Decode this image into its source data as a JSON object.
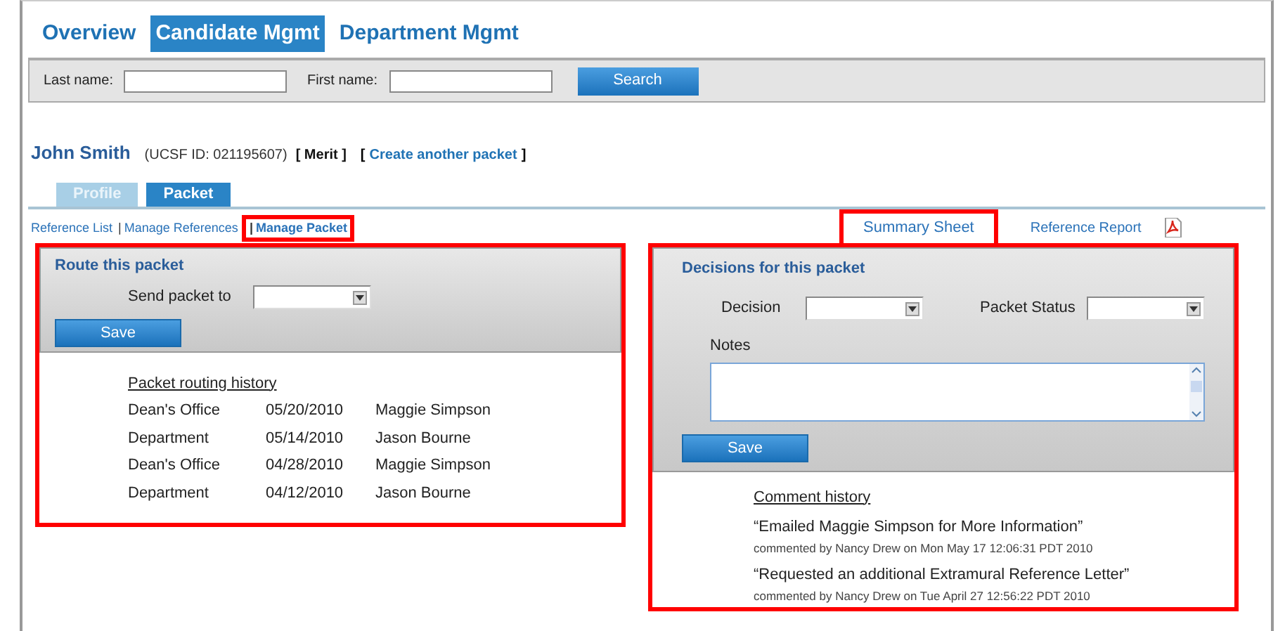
{
  "nav_tabs": [
    {
      "label": "Overview",
      "selected": false
    },
    {
      "label": "Candidate Mgmt",
      "selected": true
    },
    {
      "label": "Department Mgmt",
      "selected": false
    }
  ],
  "search": {
    "last_name_label": "Last name:",
    "first_name_label": "First name:",
    "button": "Search"
  },
  "candidate": {
    "name": "John Smith",
    "id": "(UCSF ID: 021195607)",
    "type": "[ Merit ]",
    "link_open": "[",
    "link": "Create another packet",
    "link_close": "]"
  },
  "sub_tabs": [
    {
      "label": "Profile",
      "selected": false
    },
    {
      "label": "Packet",
      "selected": true
    }
  ],
  "left_links": [
    {
      "label": "Reference List",
      "highlighted": false
    },
    {
      "separator": "|",
      "label": "Manage References",
      "highlighted": false
    },
    {
      "separator": "|",
      "label": "Manage Packet",
      "highlighted": true
    }
  ],
  "right_links": [
    {
      "kind": "link",
      "label": "Summary Sheet",
      "highlighted": true
    },
    {
      "kind": "pdf_link",
      "label": "Reference Report",
      "highlighted": false
    }
  ],
  "route_panel": {
    "title": "Route this packet",
    "highlighted": true,
    "send_label": "Send packet to",
    "save": "Save",
    "history_title": "Packet routing history",
    "history": [
      [
        "Dean's Office",
        "05/20/2010",
        "Maggie Simpson"
      ],
      [
        "Department",
        "05/14/2010",
        "Jason Bourne"
      ],
      [
        "Dean's Office",
        "04/28/2010",
        "Maggie Simpson"
      ],
      [
        "Department",
        "04/12/2010",
        "Jason Bourne"
      ]
    ]
  },
  "decision_panel": {
    "title": "Decisions for this packet",
    "highlighted": true,
    "decision_label": "Decision",
    "status_label": "Packet Status",
    "notes_label": "Notes",
    "save": "Save",
    "history_title": "Comment history",
    "comments": [
      {
        "text": "“Emailed Maggie Simpson for More Information”",
        "meta": "commented by Nancy Drew on Mon May 17 12:06:31 PDT 2010"
      },
      {
        "text": "“Requested an additional Extramural Reference Letter”",
        "meta": "commented by Nancy Drew on Tue April 27 12:56:22 PDT 2010"
      }
    ]
  }
}
